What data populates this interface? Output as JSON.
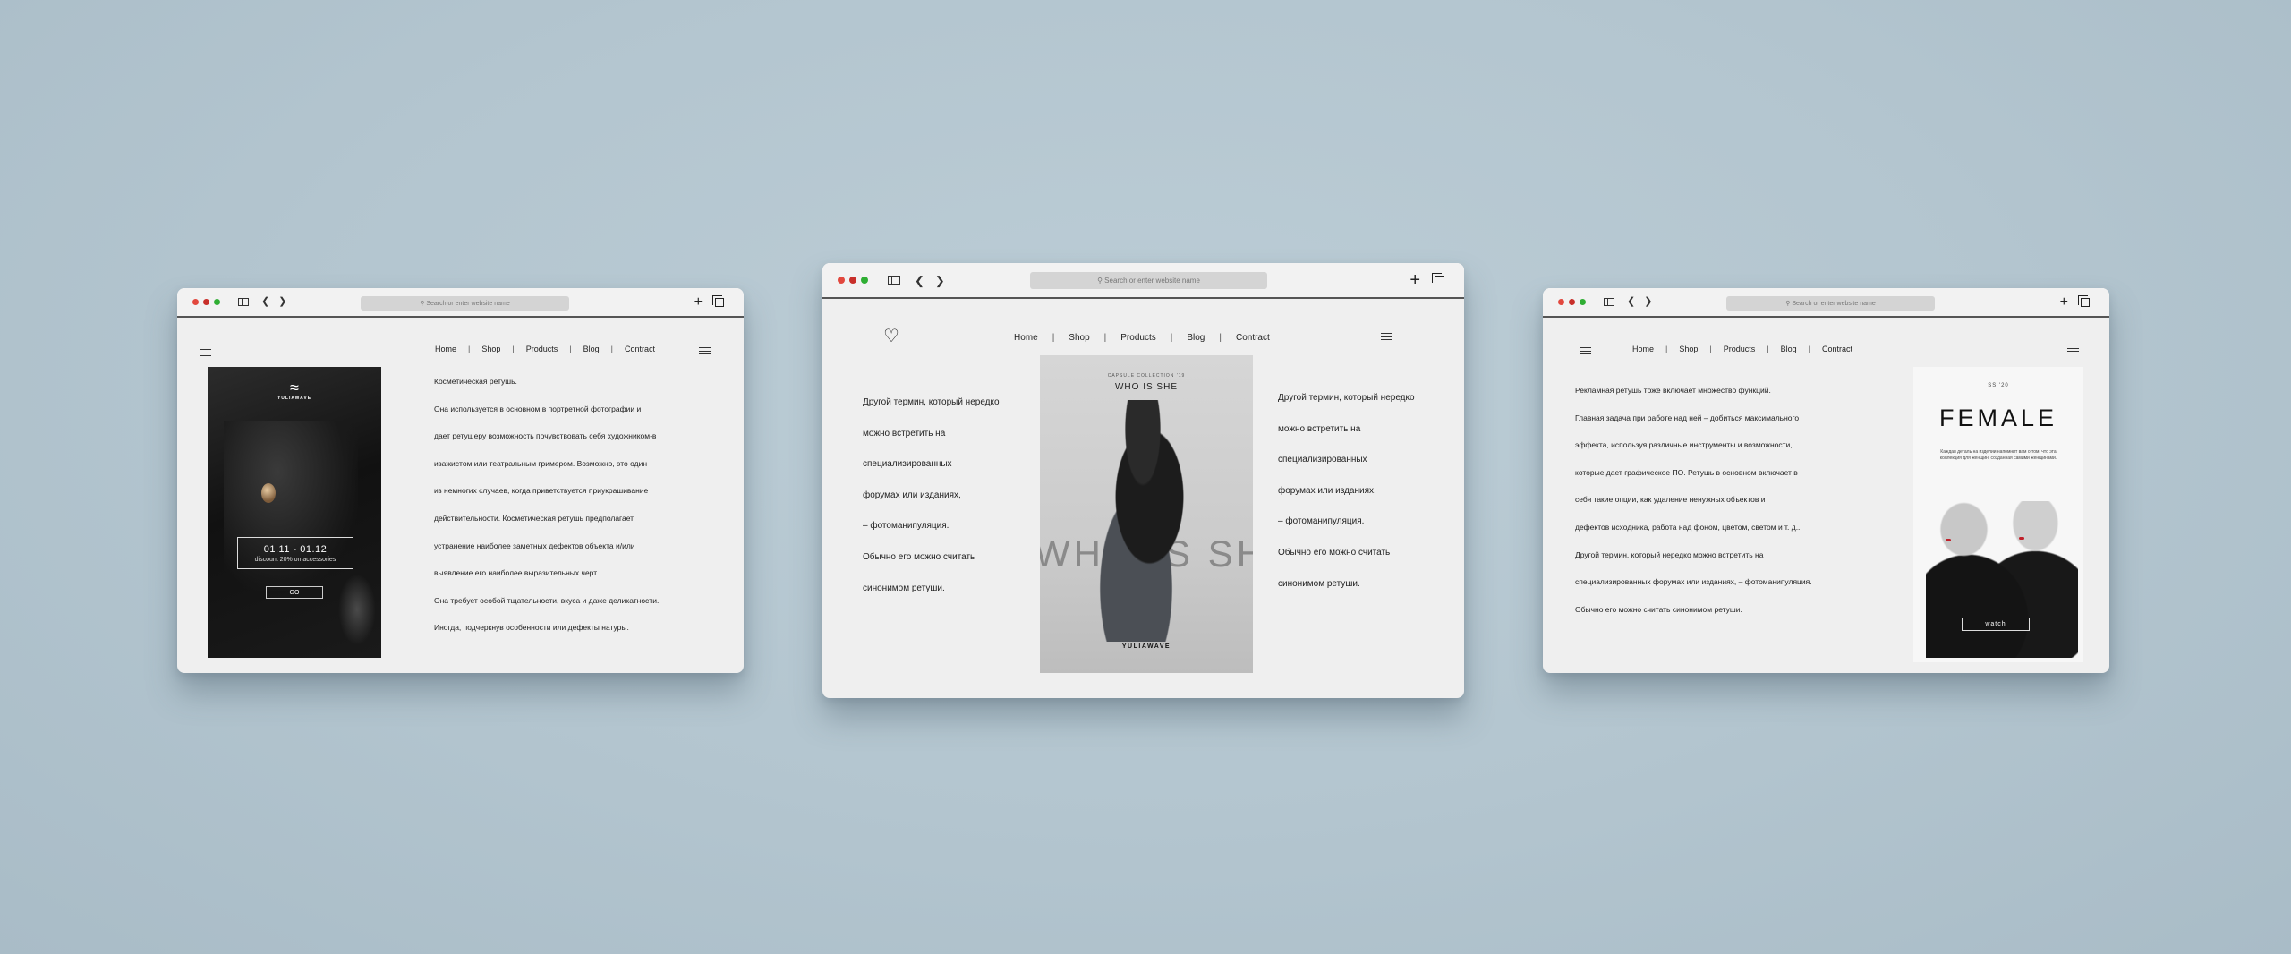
{
  "browser": {
    "address_placeholder": "Search or enter website name",
    "nav": [
      "Home",
      "Shop",
      "Products",
      "Blog",
      "Contract"
    ]
  },
  "left": {
    "brand": "YULIAWAVE",
    "promo_date": "01.11 - 01.12",
    "promo_discount": "discount 20% on accessories",
    "go_label": "GO",
    "paragraphs": [
      "Косметическая ретушь.",
      "Она используется в основном в портретной фотографии и",
      "дает ретушеру возможность почувствовать себя художником-в",
      "изажистом или театральным гримером. Возможно, это один",
      "из немногих случаев, когда приветствуется приукрашивание",
      "действительности. Косметическая ретушь предполагает",
      "устранение наиболее заметных дефектов объекта и/или",
      "выявление его наиболее выразительных черт.",
      "Она требует особой тщательности, вкуса и даже деликатности.",
      "Иногда, подчеркнув особенности или дефекты натуры."
    ]
  },
  "mid": {
    "poster_caption": "CAPSULE COLLECTION '19",
    "poster_title": "WHO IS SHE",
    "poster_bigword": "WHO IS SHE",
    "poster_brand": "YULIAWAVE",
    "col_a": [
      "Другой термин, который нередко",
      " можно встретить на",
      "специализированных",
      "форумах или изданиях,",
      "– фотоманипуляция.",
      "Обычно его можно считать",
      "синонимом ретуши."
    ],
    "col_b": [
      "Другой термин, который нередко",
      " можно встретить на",
      "специализированных",
      "форумах или изданиях,",
      "– фотоманипуляция.",
      "Обычно его можно считать",
      "синонимом ретуши."
    ]
  },
  "right": {
    "season": "SS '20",
    "title": "FEMALE",
    "subtitle": "Каждая деталь на изделии напомнит вам о том, что эта коллекция для женщин, созданная самими женщинами.",
    "watch_label": "watch",
    "paragraphs": [
      "Рекламная ретушь тоже включает множество функций.",
      "Главная задача при работе над ней – добиться максимального",
      "эффекта, используя различные инструменты и возможности,",
      "которые дает графическое ПО. Ретушь в основном включает в",
      "себя такие опции, как удаление ненужных объектов и",
      "дефектов исходника, работа над фоном, цветом, светом и т. д..",
      "Другой термин, который нередко можно встретить на",
      " специализированных форумах или изданиях, – фотоманипуляция.",
      " Обычно его можно считать синонимом ретуши."
    ]
  }
}
